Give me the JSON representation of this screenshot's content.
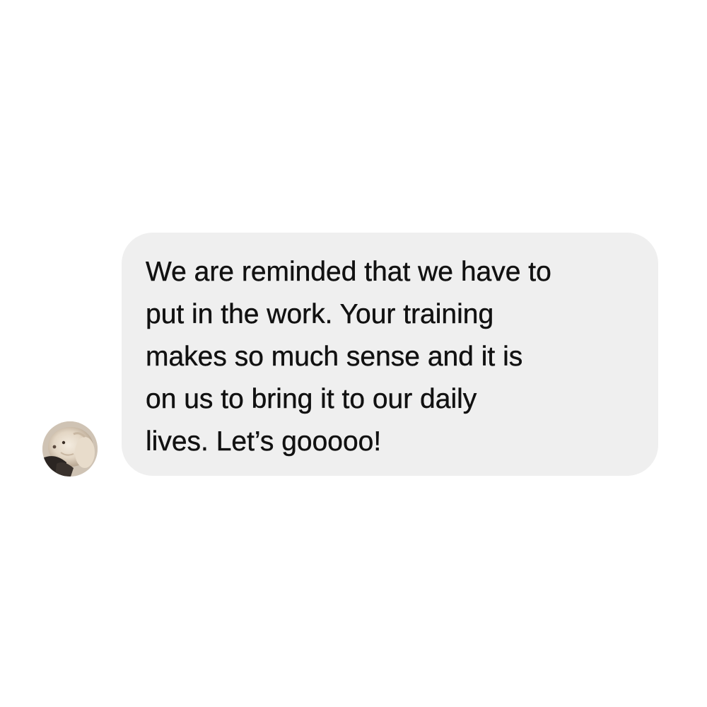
{
  "conversation": {
    "message": {
      "sender_avatar": "sender-avatar-photo",
      "lines": [
        "We are reminded that we have to",
        "put in the work. Your training",
        "makes so much sense and it is",
        "on us to bring it to our daily",
        "lives. Let’s gooooo!"
      ]
    }
  },
  "colors": {
    "background": "#ffffff",
    "bubble": "#efefef",
    "text": "#111111"
  }
}
